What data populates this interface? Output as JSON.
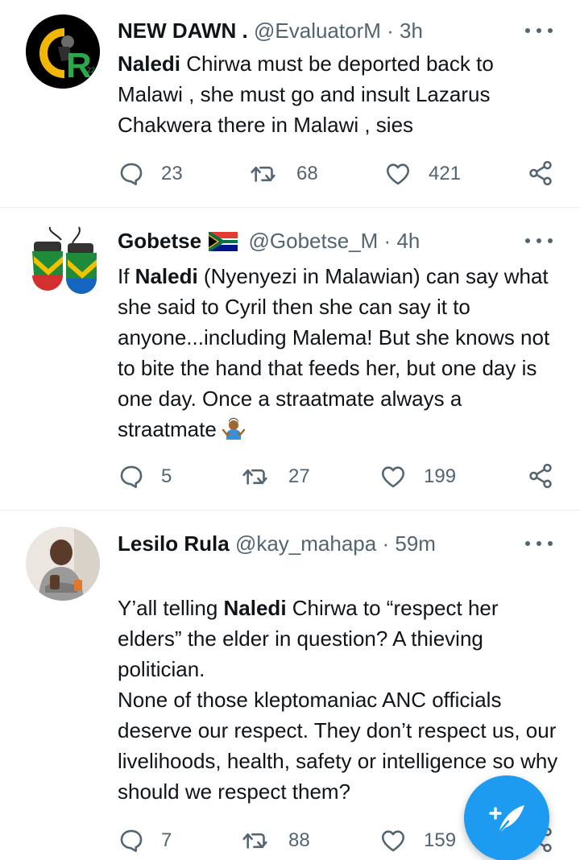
{
  "tweets": [
    {
      "name": "NEW DAWN .",
      "handle": "@EvaluatorM",
      "dot": "·",
      "time": "3h",
      "body_parts": [
        {
          "bold": true,
          "text": "Naledi"
        },
        {
          "bold": false,
          "text": " Chirwa must be deported back to Malawi , she must go and insult Lazarus Chakwera there in Malawi , sies"
        }
      ],
      "replies": "23",
      "retweets": "68",
      "likes": "421",
      "avatar_text": "R"
    },
    {
      "name": "Gobetse",
      "flag_icon": "south-africa-flag-icon",
      "handle": "@Gobetse_M",
      "dot": "·",
      "time": "4h",
      "body_parts": [
        {
          "bold": false,
          "text": "If "
        },
        {
          "bold": true,
          "text": "Naledi"
        },
        {
          "bold": false,
          "text": " (Nyenyezi in Malawian) can say what she said to Cyril then she can say it to anyone...including Malema! But she knows not to bite the hand that feeds her, but one day is one day. Once a straatmate always a straatmate"
        }
      ],
      "emoji_icon": "person-shrugging-icon",
      "replies": "5",
      "retweets": "27",
      "likes": "199"
    },
    {
      "name": "Lesilo Rula",
      "handle": "@kay_mahapa",
      "dot": "·",
      "time": "59m",
      "body_parts": [
        {
          "bold": false,
          "text": "Y’all telling "
        },
        {
          "bold": true,
          "text": "Naledi"
        },
        {
          "bold": false,
          "text": " Chirwa to “respect her elders” the elder in question? A thieving politician.\nNone of those kleptomaniac ANC officials deserve our respect. They don’t respect us, our livelihoods, health, safety or intelligence so why should we respect them?"
        }
      ],
      "replies": "7",
      "retweets": "88",
      "likes": "159"
    }
  ],
  "icons": {
    "reply": "reply-icon",
    "retweet": "retweet-icon",
    "like": "heart-icon",
    "share": "share-icon",
    "compose": "compose-tweet-icon",
    "more": "more-options-icon"
  },
  "colors": {
    "accent": "#1d9bf0",
    "text": "#0f1419",
    "secondary": "#536471",
    "divider": "#e6ecf0"
  }
}
